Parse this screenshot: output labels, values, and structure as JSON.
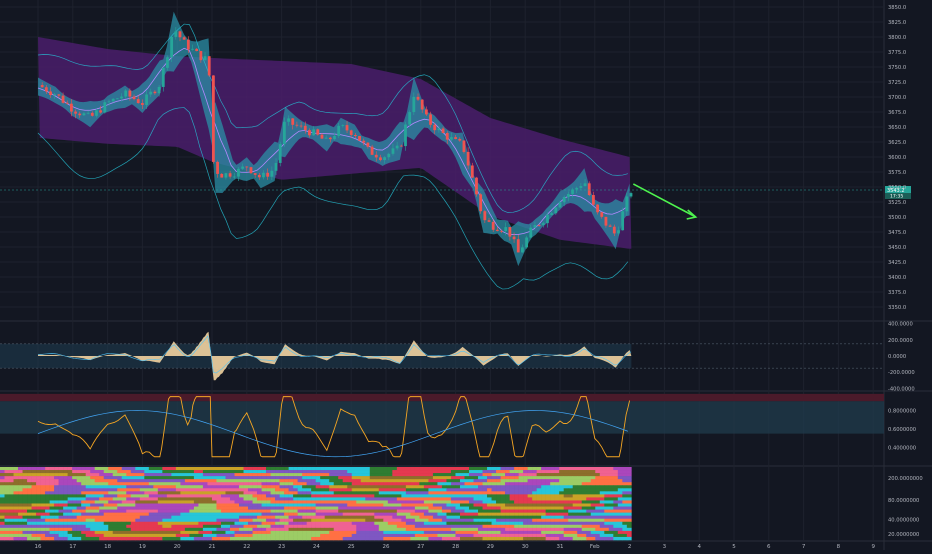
{
  "chart_data": [
    {
      "panel": "price",
      "type": "candlestick",
      "x_ticks": [
        "16",
        "17",
        "18",
        "19",
        "20",
        "21",
        "22",
        "23",
        "24",
        "25",
        "26",
        "27",
        "28",
        "29",
        "30",
        "31",
        "Feb",
        "2",
        "3",
        "4",
        "5",
        "6",
        "7",
        "8",
        "9"
      ],
      "y_ticks": [
        3350,
        3375,
        3400,
        3425,
        3450,
        3475,
        3500,
        3525,
        3550,
        3575,
        3600,
        3625,
        3650,
        3675,
        3700,
        3725,
        3750,
        3775,
        3800,
        3825,
        3850
      ],
      "ylim": [
        3335,
        3855
      ],
      "last_price_label": "3543.2",
      "countdown_label": "17:35",
      "colors": {
        "up": "#26a69a",
        "down": "#ef5350",
        "cloud": "#2b8fa6",
        "outer_band": "#4a1d6b",
        "forecast_arrow": "#4ef34e"
      },
      "close_path": [
        [
          0,
          3720
        ],
        [
          0.5,
          3705
        ],
        [
          1.0,
          3680
        ],
        [
          1.5,
          3665
        ],
        [
          2.0,
          3690
        ],
        [
          2.5,
          3705
        ],
        [
          3.0,
          3690
        ],
        [
          3.5,
          3722
        ],
        [
          3.9,
          3815
        ],
        [
          4.2,
          3790
        ],
        [
          4.6,
          3770
        ],
        [
          4.9,
          3760
        ],
        [
          5.05,
          3580
        ],
        [
          5.3,
          3570
        ],
        [
          5.7,
          3575
        ],
        [
          6.0,
          3585
        ],
        [
          6.4,
          3565
        ],
        [
          6.8,
          3580
        ],
        [
          7.1,
          3660
        ],
        [
          7.5,
          3650
        ],
        [
          7.9,
          3640
        ],
        [
          8.3,
          3625
        ],
        [
          8.7,
          3650
        ],
        [
          9.1,
          3640
        ],
        [
          9.5,
          3610
        ],
        [
          9.9,
          3600
        ],
        [
          10.4,
          3615
        ],
        [
          10.8,
          3705
        ],
        [
          11.2,
          3660
        ],
        [
          11.6,
          3640
        ],
        [
          12.0,
          3625
        ],
        [
          12.2,
          3620
        ],
        [
          12.5,
          3560
        ],
        [
          12.8,
          3495
        ],
        [
          13.1,
          3485
        ],
        [
          13.5,
          3480
        ],
        [
          13.8,
          3440
        ],
        [
          14.2,
          3480
        ],
        [
          14.6,
          3500
        ],
        [
          15.0,
          3530
        ],
        [
          15.4,
          3545
        ],
        [
          15.7,
          3560
        ],
        [
          16.0,
          3510
        ],
        [
          16.3,
          3490
        ],
        [
          16.6,
          3470
        ],
        [
          16.9,
          3525
        ],
        [
          17.05,
          3545
        ]
      ],
      "upper_band_1": [
        [
          0,
          3790
        ],
        [
          2,
          3770
        ],
        [
          4,
          3758
        ],
        [
          5,
          3755
        ],
        [
          7,
          3750
        ],
        [
          9,
          3745
        ],
        [
          11,
          3720
        ],
        [
          13,
          3655
        ],
        [
          15,
          3620
        ],
        [
          17,
          3590
        ]
      ],
      "lower_band_1": [
        [
          0,
          3640
        ],
        [
          2,
          3630
        ],
        [
          4,
          3625
        ],
        [
          5,
          3600
        ],
        [
          7,
          3570
        ],
        [
          9,
          3580
        ],
        [
          11,
          3590
        ],
        [
          13,
          3510
        ],
        [
          15,
          3470
        ],
        [
          17,
          3455
        ]
      ]
    },
    {
      "panel": "oscillator_1",
      "type": "area",
      "y_ticks": [
        400,
        200,
        0,
        -200,
        -400
      ],
      "ylim": [
        -420,
        420
      ],
      "y_tick_labels": [
        "400.0000",
        "200.0000",
        "0.0000",
        "-200.0000",
        "-400.0000"
      ]
    },
    {
      "panel": "oscillator_2",
      "type": "line",
      "y_ticks": [
        0.8,
        0.6,
        0.4
      ],
      "ylim": [
        0.2,
        1.0
      ],
      "y_tick_labels": [
        "0.8000000",
        "0.6000000",
        "0.4000000"
      ]
    },
    {
      "panel": "heatmap",
      "type": "heatmap",
      "y_tick_labels": [
        "200.0000000",
        "80.0000000",
        "40.0000000",
        "20.0000000"
      ]
    }
  ]
}
